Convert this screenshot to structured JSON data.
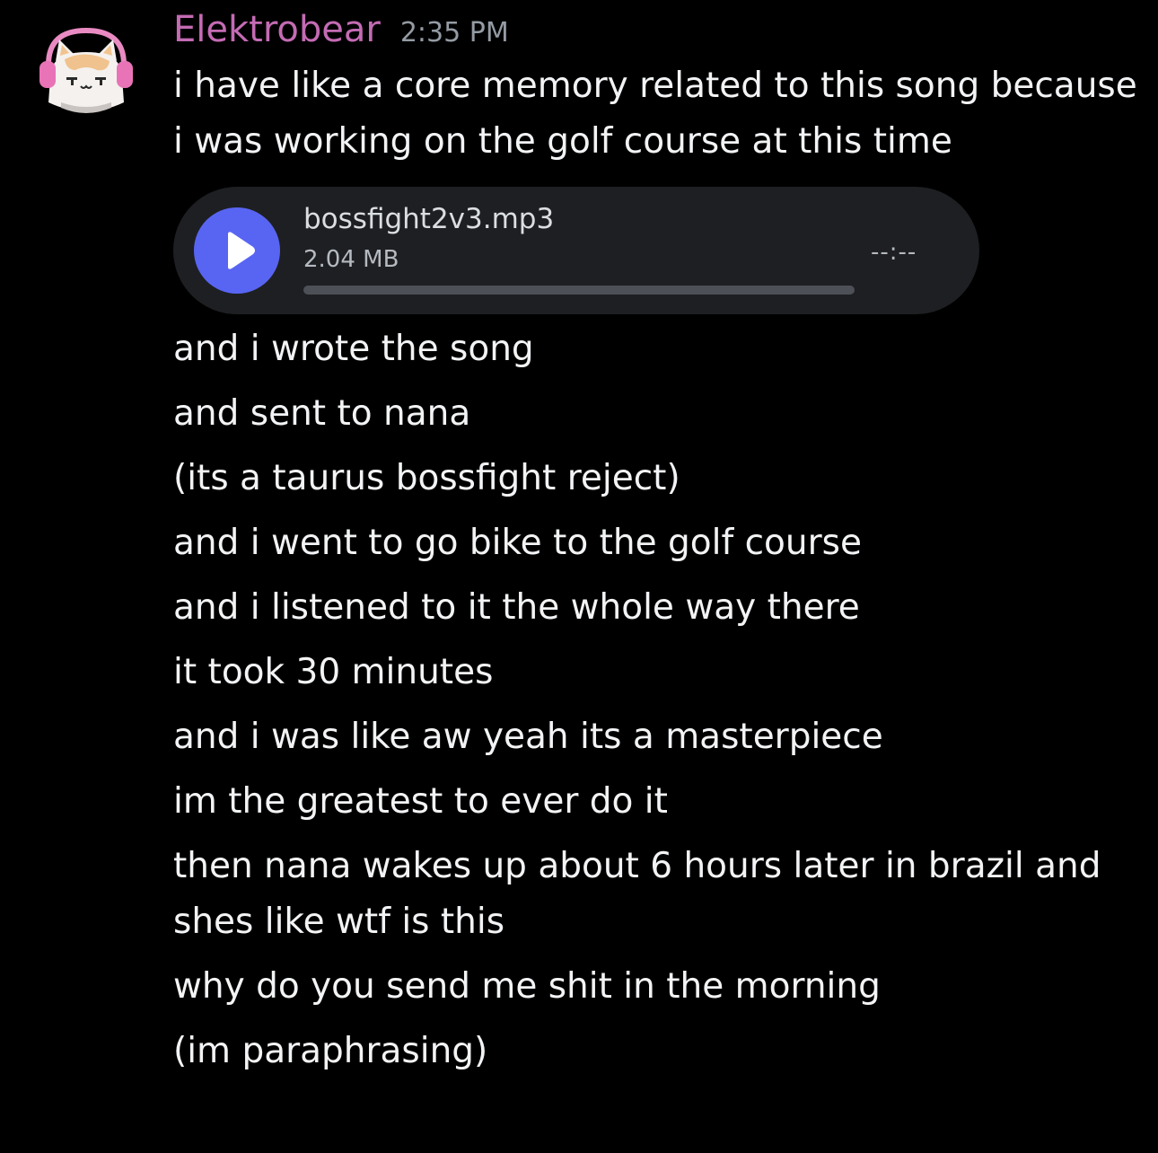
{
  "message": {
    "username": "Elektrobear",
    "timestamp": "2:35 PM",
    "avatar_icon": "cat-with-headphones-avatar-icon",
    "colors": {
      "username": "#c46bb4",
      "play_button": "#5865f2",
      "attachment_bg": "#1e1f22"
    },
    "first_text": "i have like a core memory related to this song because i was working on the golf course at this time",
    "attachment": {
      "file_name": "bossfight2v3.mp3",
      "file_size": "2.04 MB",
      "duration": "--:--",
      "play_icon": "play-icon"
    },
    "lines": [
      "and i wrote the song",
      "and sent to nana",
      "(its a taurus bossfight reject)",
      "and i went to go bike to the golf course",
      "and i listened to it the whole way there",
      "it took 30 minutes",
      "and i was like aw yeah its a masterpiece",
      "im the greatest to ever do it",
      "then nana wakes up about 6 hours later in brazil and shes like wtf is this",
      "why do you send me shit in the morning",
      "(im paraphrasing)"
    ]
  }
}
